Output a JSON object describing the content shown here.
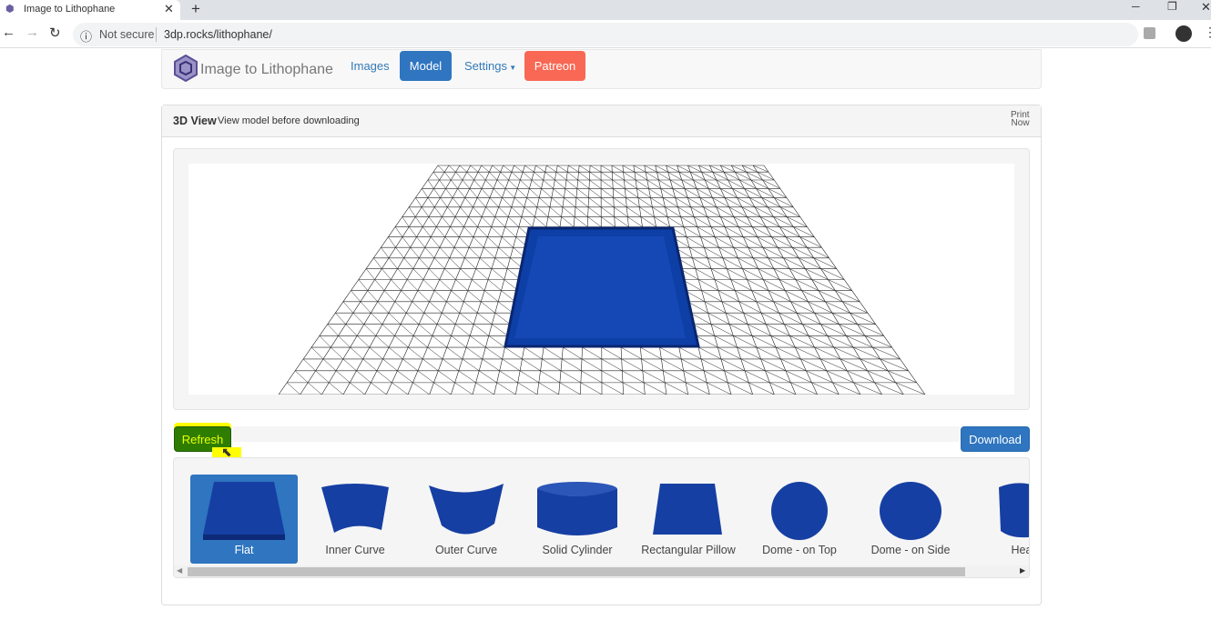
{
  "browser": {
    "tab_title": "Image to Lithophane",
    "security": "Not secure",
    "url": "3dp.rocks/lithophane/"
  },
  "nav": {
    "brand": "Image to Lithophane",
    "items": [
      "Images",
      "Model",
      "Settings",
      "Patreon"
    ],
    "active": "Model"
  },
  "panel": {
    "title": "3D View",
    "subtitle": "View model before downloading",
    "print_now": [
      "Print",
      "Now"
    ]
  },
  "actions": {
    "refresh": "Refresh",
    "download": "Download",
    "progress": 0
  },
  "shapes": {
    "selected": "Flat",
    "items": [
      "Flat",
      "Inner Curve",
      "Outer Curve",
      "Solid Cylinder",
      "Rectangular Pillow",
      "Dome - on Top",
      "Dome - on Side",
      "Hea"
    ]
  },
  "colors": {
    "primary": "#2f75c0",
    "patreon": "#f96854",
    "refresh": "#2e7d00",
    "model": "#0d3fa6"
  }
}
